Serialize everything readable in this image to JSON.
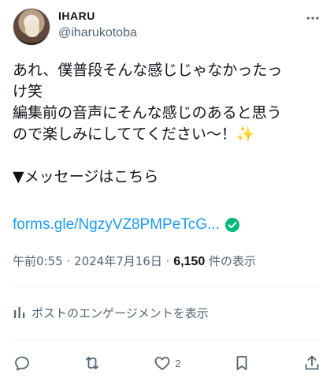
{
  "author": {
    "display_name": "IHARU",
    "handle": "@iharukotoba"
  },
  "tweet": {
    "lines": [
      "あれ、僕普段そんな感じじゃなかったっ",
      "け笑",
      "編集前の音声にそんな感じのあると思う",
      "ので楽しみにしててください～！"
    ],
    "sparkles_emoji": "✨",
    "section_line": "▼メッセージはこちら",
    "link_text": "forms.gle/NgzyVZ8PMPeTcG..."
  },
  "meta": {
    "time": "午前0:55",
    "separator": "·",
    "date": "2024年7月16日",
    "views_count": "6,150",
    "views_label": "件の表示"
  },
  "engagement_label": "ポストのエンゲージメントを表示",
  "actions": {
    "like_count": "2"
  },
  "colors": {
    "link": "#1d9bf0",
    "verified": "#00ba7c",
    "muted": "#536471",
    "text": "#0f1419"
  }
}
